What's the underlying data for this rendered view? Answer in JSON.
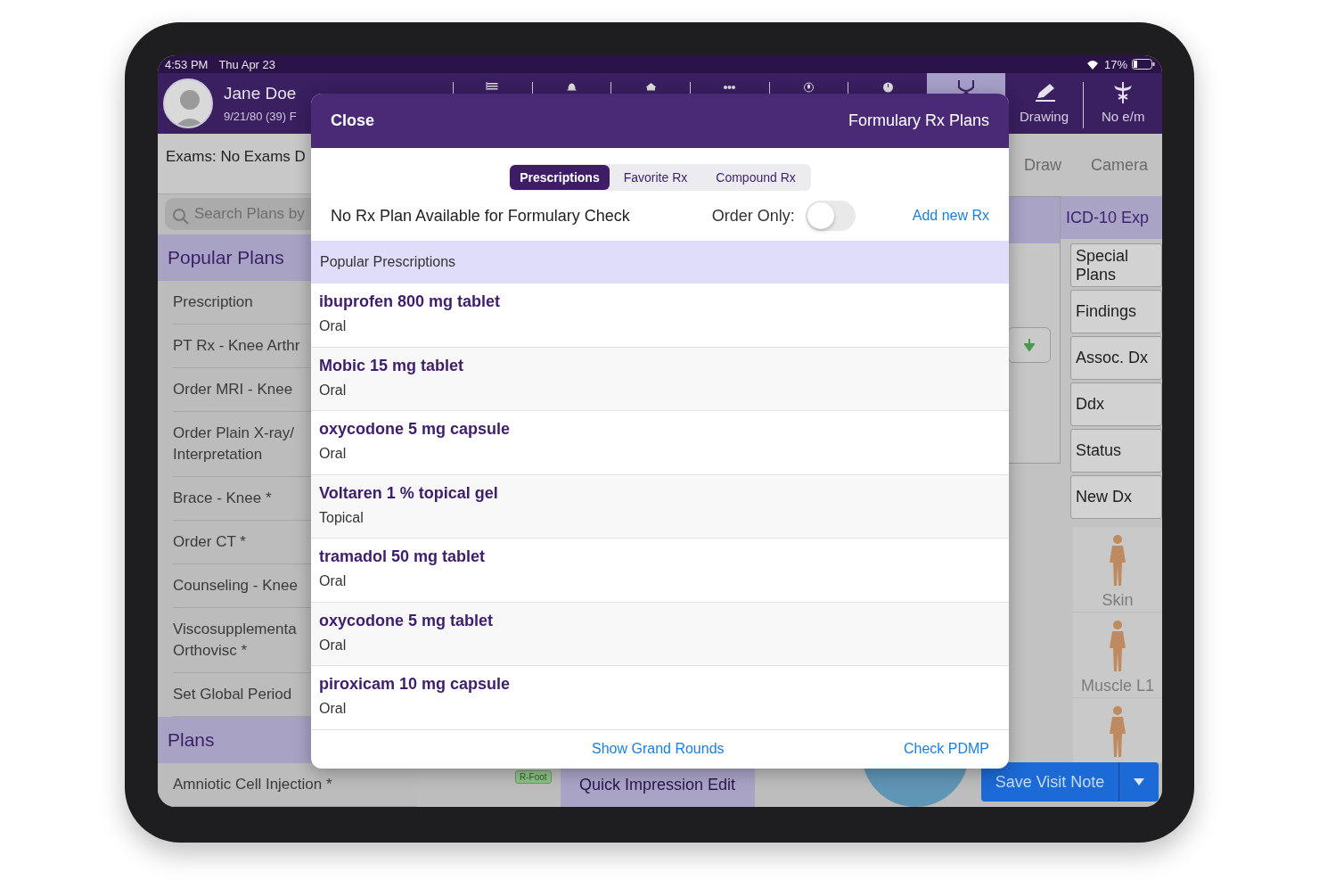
{
  "status_bar": {
    "time": "4:53 PM",
    "date": "Thu Apr 23",
    "battery": "17%"
  },
  "patient": {
    "name": "Jane Doe",
    "details": "9/21/80 (39) F"
  },
  "toolbar": [
    {
      "kind": "list",
      "selected": false
    },
    {
      "kind": "bell",
      "selected": false
    },
    {
      "kind": "house",
      "selected": false
    },
    {
      "kind": "dots",
      "selected": false
    },
    {
      "kind": "mic",
      "selected": false
    },
    {
      "kind": "clock",
      "selected": false
    },
    {
      "kind": "stethoscope",
      "selected": true
    },
    {
      "kind": "drawing",
      "label": "Drawing",
      "selected": false
    },
    {
      "kind": "em",
      "label": "No e/m",
      "selected": false
    }
  ],
  "left_panel": {
    "exams": "Exams: No Exams D",
    "search": {
      "placeholder": "Search Plans by"
    },
    "sections": [
      {
        "title": "Popular Plans",
        "items": [
          "Prescription",
          "PT Rx - Knee Arthr",
          "Order MRI - Knee",
          "Order Plain X-ray/\nInterpretation",
          "Brace - Knee *",
          "Order CT *",
          "Counseling - Knee",
          "Viscosupplementa\nOrthovisc *",
          "Set Global Period"
        ]
      },
      {
        "title": "Plans",
        "items": [
          "Amniotic Cell Injection *"
        ]
      }
    ]
  },
  "workspace": {
    "tools": [
      "Draw",
      "Camera"
    ],
    "side_tab": "ICD-10 Exp",
    "side_buttons": [
      "Special\nPlans",
      "Findings",
      "Assoc. Dx",
      "Ddx",
      "Status",
      "New Dx"
    ],
    "figures": [
      {
        "kind": "labeled",
        "label": "Skin"
      },
      {
        "kind": "labeled",
        "label": "Muscle L1"
      },
      {
        "kind": "unlabeled"
      }
    ],
    "bottom_bar": {
      "tag": "R-Foot",
      "tab": "Quick Impression Edit",
      "save_button": "Save Visit Note"
    }
  },
  "modal": {
    "close": "Close",
    "title": "Formulary Rx Plans",
    "segments": [
      {
        "label": "Prescriptions",
        "selected": true
      },
      {
        "label": "Favorite Rx",
        "selected": false
      },
      {
        "label": "Compound Rx",
        "selected": false
      }
    ],
    "notice": "No Rx Plan Available for Formulary Check",
    "order_only": {
      "label": "Order Only:",
      "on": false
    },
    "add_link": "Add new Rx",
    "section": "Popular Prescriptions",
    "prescriptions": [
      {
        "name": "ibuprofen 800 mg tablet",
        "route": "Oral"
      },
      {
        "name": "Mobic 15 mg tablet",
        "route": "Oral"
      },
      {
        "name": "oxycodone 5 mg capsule",
        "route": "Oral"
      },
      {
        "name": "Voltaren 1 % topical gel",
        "route": "Topical"
      },
      {
        "name": "tramadol 50 mg tablet",
        "route": "Oral"
      },
      {
        "name": "oxycodone 5 mg tablet",
        "route": "Oral"
      },
      {
        "name": "piroxicam 10 mg capsule",
        "route": "Oral"
      }
    ],
    "footer_links": [
      "Show Grand Rounds",
      "Check PDMP"
    ]
  }
}
